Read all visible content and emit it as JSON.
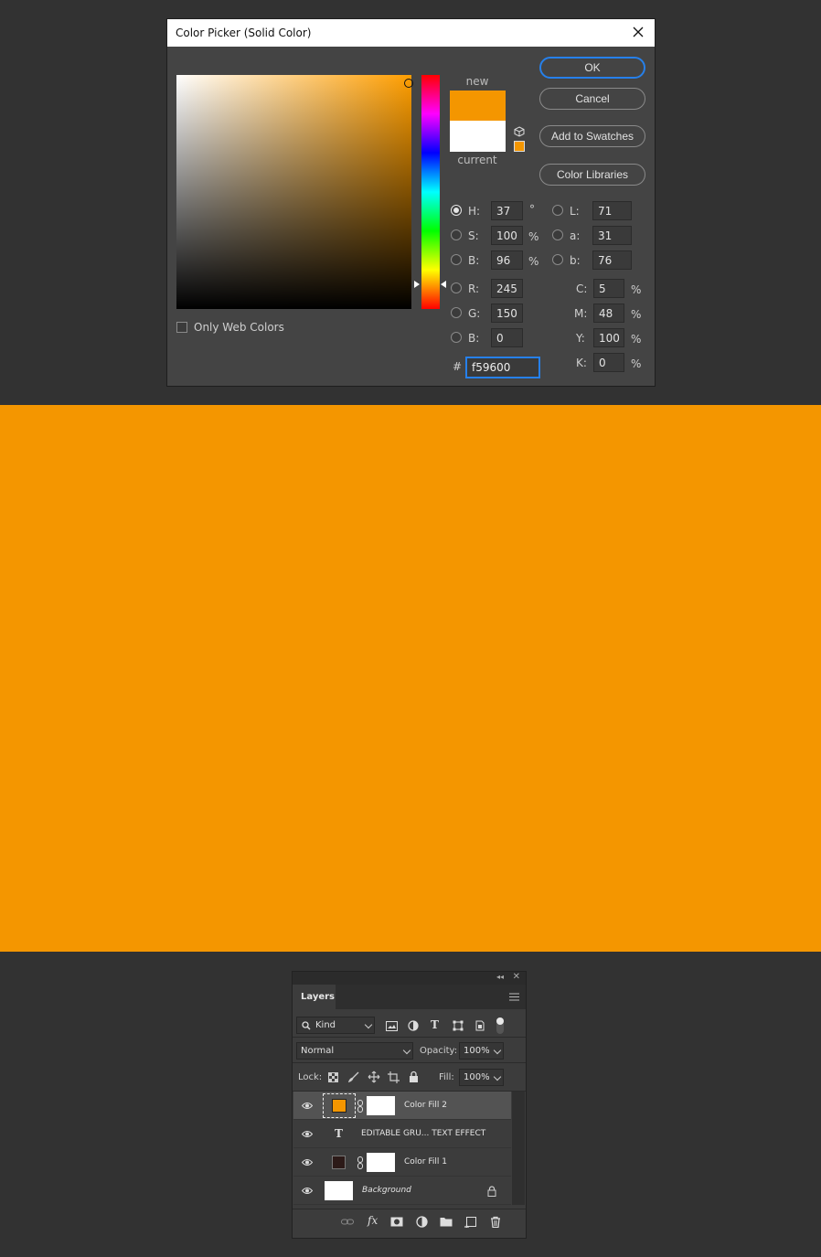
{
  "dialog": {
    "title": "Color Picker (Solid Color)",
    "new_label": "new",
    "current_label": "current",
    "new_color": "#f49600",
    "current_color": "#ffffff",
    "only_web_colors": "Only Web Colors",
    "buttons": {
      "ok": "OK",
      "cancel": "Cancel",
      "add_swatches": "Add to Swatches",
      "color_libraries": "Color Libraries"
    },
    "hsb": {
      "h_label": "H:",
      "h": "37",
      "h_unit": "°",
      "s_label": "S:",
      "s": "100",
      "s_unit": "%",
      "b_label": "B:",
      "b": "96",
      "b_unit": "%"
    },
    "lab": {
      "l_label": "L:",
      "l": "71",
      "a_label": "a:",
      "a": "31",
      "b_label": "b:",
      "b": "76"
    },
    "rgb": {
      "r_label": "R:",
      "r": "245",
      "g_label": "G:",
      "g": "150",
      "b_label": "B:",
      "b": "0"
    },
    "cmyk": {
      "c_label": "C:",
      "c": "5",
      "m_label": "M:",
      "m": "48",
      "y_label": "Y:",
      "y": "100",
      "k_label": "K:",
      "k": "0",
      "unit": "%"
    },
    "hex_label": "#",
    "hex": "f59600"
  },
  "canvas": {
    "fill_color": "#f49600"
  },
  "layers_panel": {
    "tab": "Layers",
    "filter_kind": "Kind",
    "blend_mode": "Normal",
    "opacity_label": "Opacity:",
    "opacity": "100%",
    "lock_label": "Lock:",
    "fill_label": "Fill:",
    "fill": "100%",
    "layers": [
      {
        "name": "Color Fill 2",
        "selected": true,
        "swatch": "#f49600"
      },
      {
        "name": "EDITABLE GRU... TEXT EFFECT",
        "type_icon": "T"
      },
      {
        "name": "Color Fill 1",
        "swatch": "#2c1a18"
      },
      {
        "name": "Background",
        "locked": true
      }
    ]
  }
}
